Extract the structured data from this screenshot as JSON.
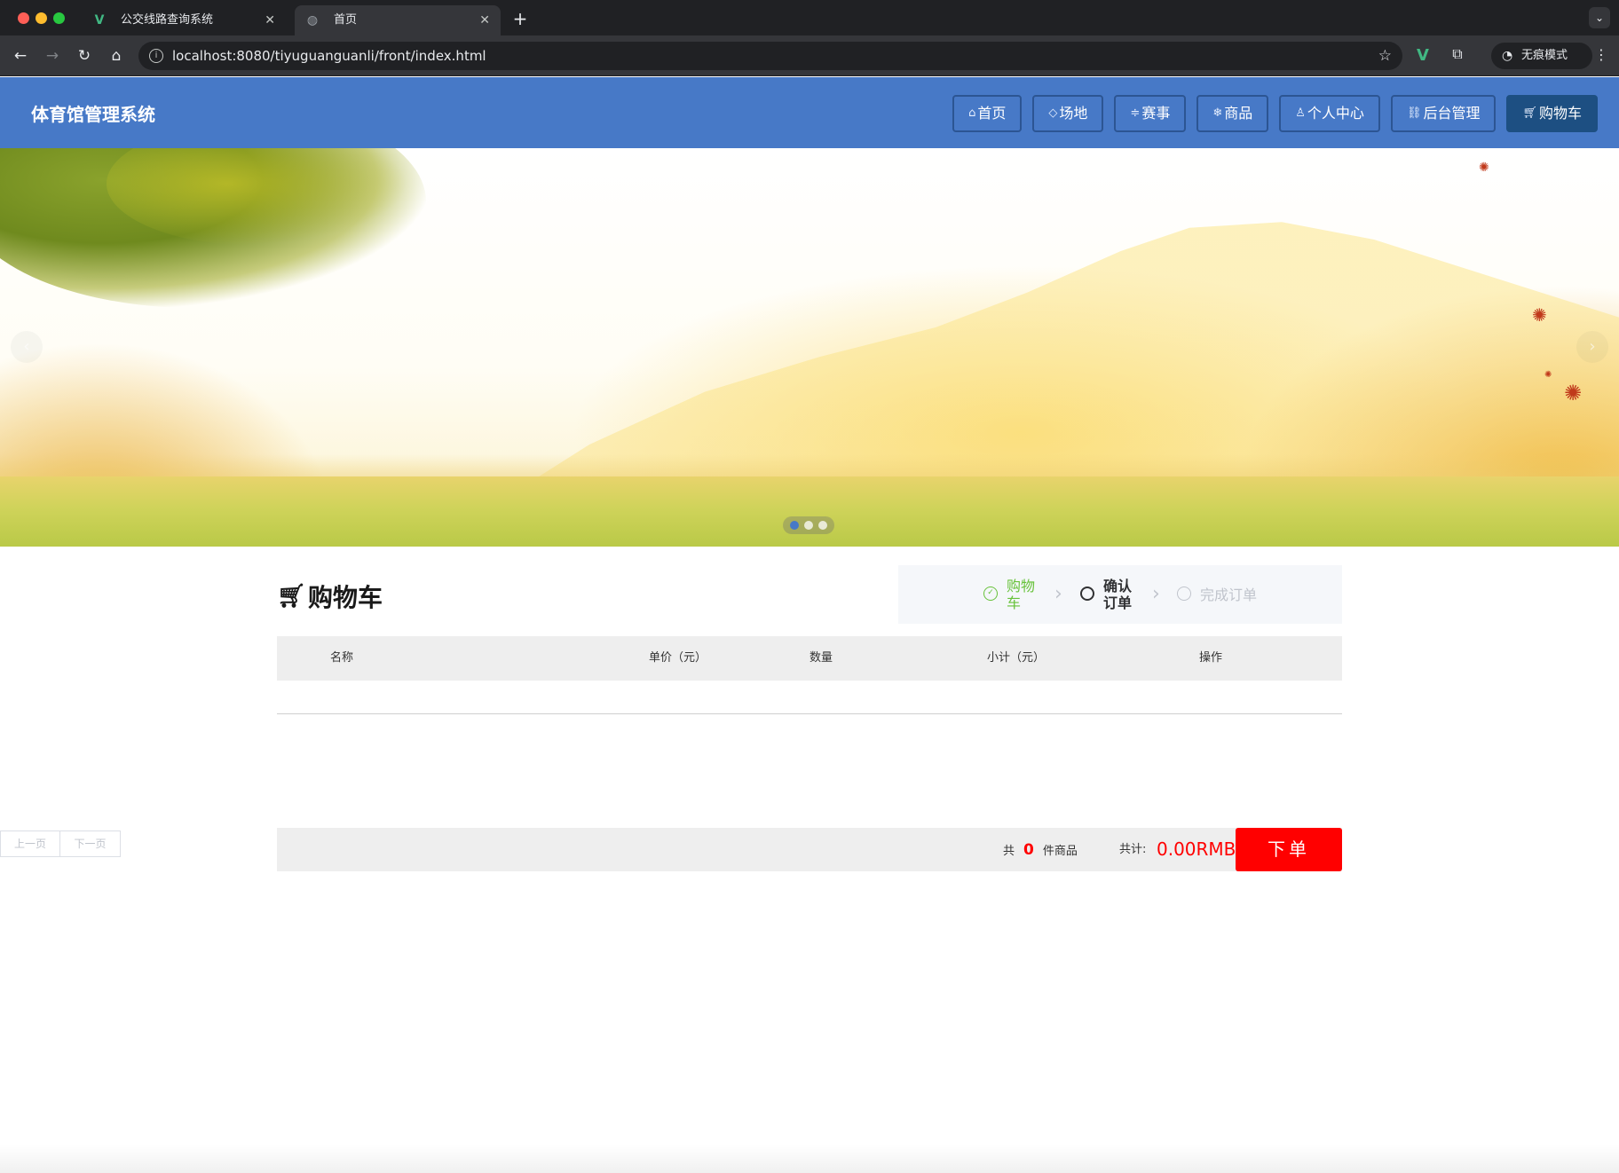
{
  "browser": {
    "tabs": [
      {
        "title": "公交线路查询系统",
        "favicon": "vue-icon"
      },
      {
        "title": "首页",
        "favicon": "globe-icon",
        "active": true
      }
    ],
    "url": "localhost:8080/tiyuguanguanli/front/index.html",
    "incognito_label": "无痕模式"
  },
  "header": {
    "site_title": "体育馆管理系统",
    "nav": [
      {
        "label": "首页",
        "icon": "home-icon"
      },
      {
        "label": "场地",
        "icon": "tag-icon"
      },
      {
        "label": "赛事",
        "icon": "sliders-icon"
      },
      {
        "label": "商品",
        "icon": "snowflake-icon"
      },
      {
        "label": "个人中心",
        "icon": "user-icon"
      },
      {
        "label": "后台管理",
        "icon": "link-icon"
      },
      {
        "label": "购物车",
        "icon": "cart-icon",
        "active": true
      }
    ],
    "colors": {
      "header_bg": "#4779c7",
      "active_bg": "#1d4f82"
    }
  },
  "banner": {
    "slide_count": 3,
    "active_slide": 1
  },
  "cart": {
    "title": "购物车",
    "steps": [
      {
        "label": "购物车",
        "status": "done"
      },
      {
        "label": "确认订单",
        "status": "current"
      },
      {
        "label": "完成订单",
        "status": "pending"
      }
    ],
    "columns": [
      "名称",
      "单价（元）",
      "数量",
      "小计（元）",
      "操作"
    ],
    "rows": [],
    "pager": {
      "prev": "上一页",
      "next": "下一页"
    },
    "summary": {
      "count_prefix": "共",
      "count": "0",
      "count_suffix": "件商品",
      "total_label": "共计:",
      "total": "0.00RMB",
      "order_button": "下单"
    },
    "colors": {
      "accent": "#ff0000",
      "step_done": "#67c23a"
    }
  }
}
